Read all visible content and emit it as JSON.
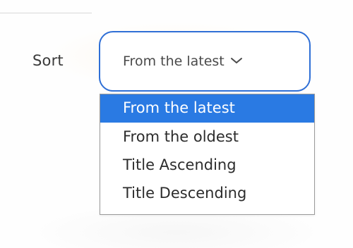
{
  "sort": {
    "label": "Sort",
    "selected_value": "From the latest",
    "options": [
      {
        "label": "From the latest",
        "selected": true
      },
      {
        "label": "From the oldest",
        "selected": false
      },
      {
        "label": "Title Ascending",
        "selected": false
      },
      {
        "label": "Title Descending",
        "selected": false
      }
    ],
    "dropdown_icon": "chevron-down-icon"
  },
  "colors": {
    "accent": "#2f6fd6",
    "selected_option_bg": "#2a7ae3",
    "text": "#3a3a3a"
  }
}
